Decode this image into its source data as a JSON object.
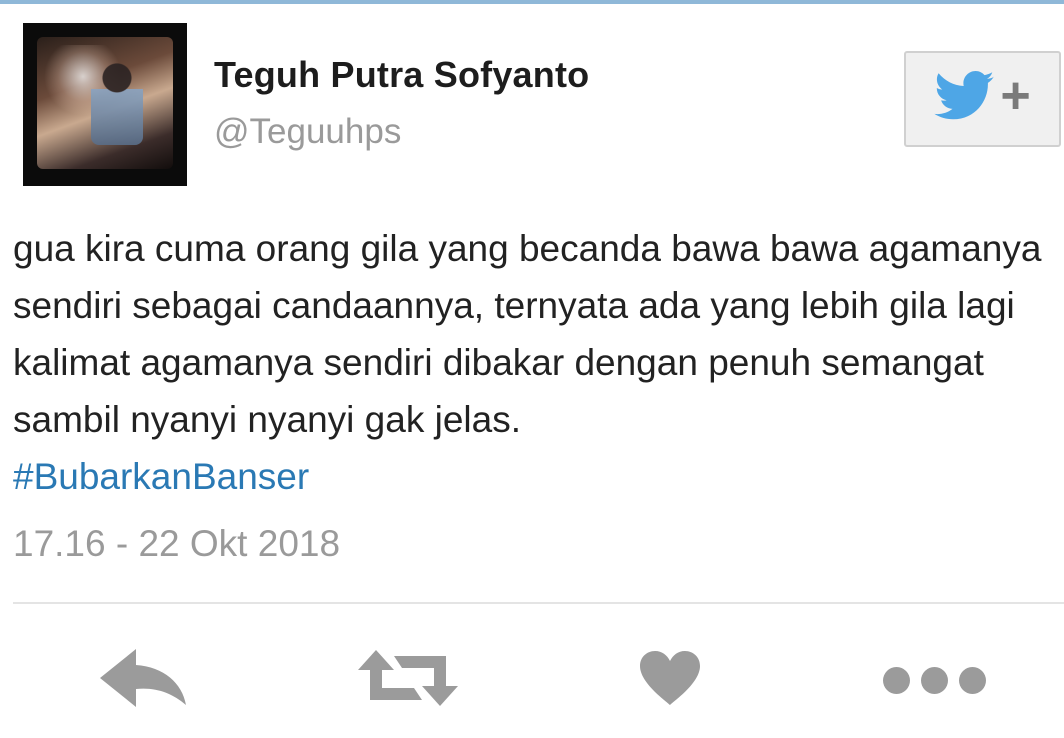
{
  "tweet": {
    "author_name": "Teguh Putra Sofyanto",
    "author_handle": "@Teguuhps",
    "text": "gua kira cuma orang gila yang becanda bawa bawa agamanya sendiri sebagai candaannya, ternyata ada yang lebih gila lagi kalimat agamanya sendiri dibakar dengan penuh semangat sambil nyanyi nyanyi gak jelas.",
    "hashtag": "#BubarkanBanser",
    "timestamp": "17.16 - 22 Okt 2018"
  },
  "follow_button": {
    "icon": "twitter-bird-icon",
    "plus": "+"
  },
  "actions": [
    {
      "icon": "reply-icon"
    },
    {
      "icon": "retweet-icon"
    },
    {
      "icon": "heart-icon"
    },
    {
      "icon": "more-icon"
    }
  ],
  "colors": {
    "hashtag": "#2a79b4",
    "twitter_blue": "#4ea6e6",
    "icon_gray": "#9b9b9b",
    "muted_text": "#9a9a9a"
  }
}
